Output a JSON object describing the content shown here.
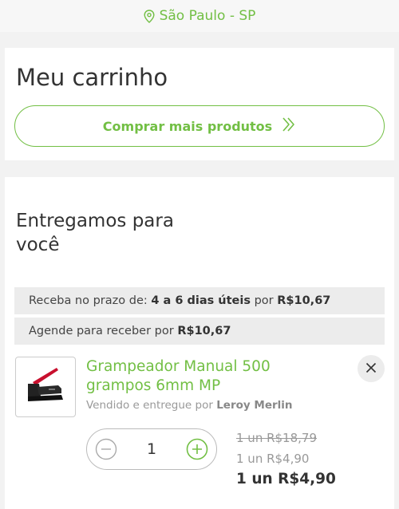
{
  "location": {
    "icon": "location-pin-icon",
    "text": "São Paulo - SP"
  },
  "cart": {
    "title": "Meu carrinho",
    "more_products_label": "Comprar mais produtos",
    "more_products_icon": "double-chevron-right-icon"
  },
  "delivery": {
    "title": "Entregamos para você",
    "options": [
      {
        "prefix": "Receba no prazo de:",
        "term": "4 a 6 dias úteis",
        "connector": "por",
        "price": "R$10,67"
      },
      {
        "prefix": "Agende para receber por",
        "price": "R$10,67"
      }
    ]
  },
  "product": {
    "image": "stapler-image",
    "name": "Grampeador Manual 500 grampos 6mm MP",
    "seller_prefix": "Vendido e entregue por",
    "seller": "Leroy Merlin",
    "quantity": "1",
    "price_old": "1 un R$18,79",
    "price_unit": "1 un R$4,90",
    "price_total": "1 un R$4,90"
  },
  "colors": {
    "accent": "#72bf44",
    "background": "#f2f2f2",
    "row": "#ececec"
  }
}
